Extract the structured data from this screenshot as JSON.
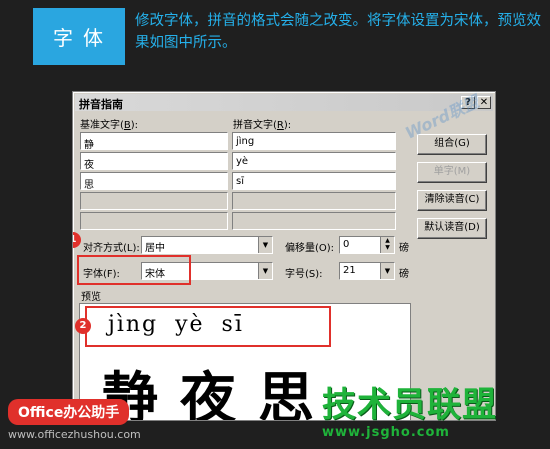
{
  "banner": {
    "tag": "字体",
    "headline": "修改字体，拼音的格式会随之改变。将字体设置为宋体，预览效果如图中所示。"
  },
  "dialog": {
    "title": "拼音指南",
    "help_btn": "?",
    "close_btn": "✕",
    "base_text_label_prefix": "基准文字(",
    "base_text_label_key": "B",
    "base_text_label_suffix": "):",
    "pinyin_text_label_prefix": "拼音文字(",
    "pinyin_text_label_key": "R",
    "pinyin_text_label_suffix": "):",
    "rows": [
      {
        "base": "静",
        "pinyin": "jìng"
      },
      {
        "base": "夜",
        "pinyin": "yè"
      },
      {
        "base": "思",
        "pinyin": "sī"
      },
      {
        "base": "",
        "pinyin": ""
      },
      {
        "base": "",
        "pinyin": ""
      }
    ],
    "buttons": {
      "combine": "组合(G)",
      "single": "单字(M)",
      "clear": "清除读音(C)",
      "default": "默认读音(D)"
    },
    "align_label": "对齐方式(L):",
    "align_value": "居中",
    "offset_label": "偏移量(O):",
    "offset_value": "0",
    "offset_unit": "磅",
    "font_label": "字体(F):",
    "font_value": "宋体",
    "size_label": "字号(S):",
    "size_value": "21",
    "size_unit": "磅",
    "preview_label": "预览",
    "preview_pinyin": "jìng yè  sī",
    "preview_hanzi": "静夜思",
    "badge1": "1",
    "badge2": "2"
  },
  "watermarks": {
    "word": "Word联盟",
    "office_badge": "Office办公助手",
    "url_left": "www.officezhushou.com",
    "brand": "技术员联盟",
    "url_right": "www.jsgho.com"
  },
  "colors": {
    "accent_blue": "#2aa6e0",
    "highlight_red": "#e0302b",
    "brand_green": "#1fb33a"
  }
}
